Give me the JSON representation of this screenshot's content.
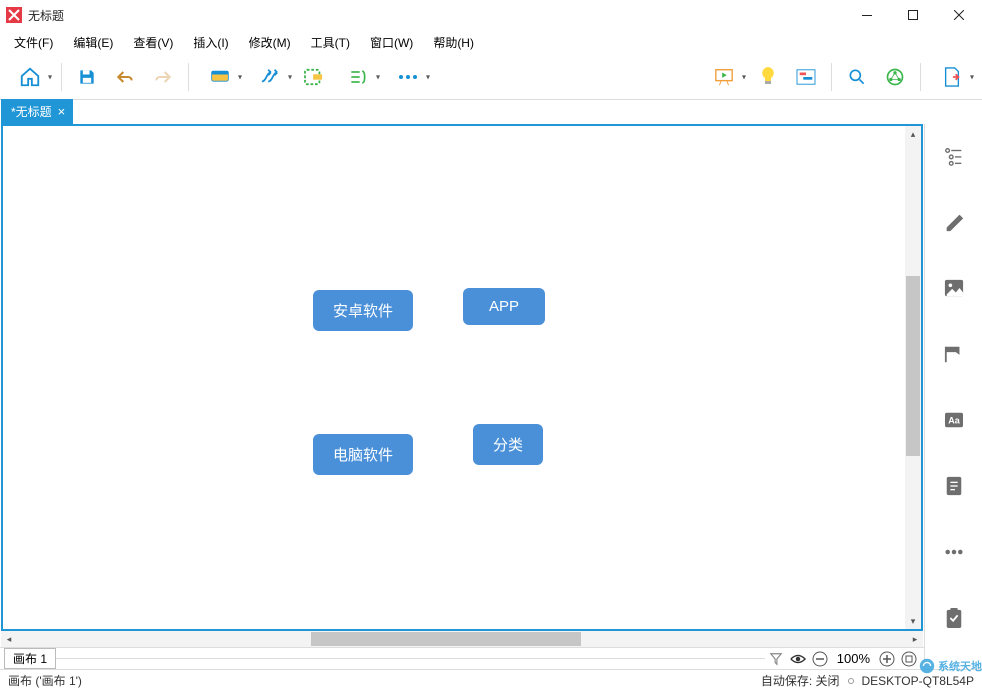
{
  "window": {
    "title": "无标题"
  },
  "menubar": {
    "items": [
      "文件(F)",
      "编辑(E)",
      "查看(V)",
      "插入(I)",
      "修改(M)",
      "工具(T)",
      "窗口(W)",
      "帮助(H)"
    ]
  },
  "tabs": [
    {
      "label": "*无标题"
    }
  ],
  "canvas": {
    "nodes": [
      {
        "label": "安卓软件"
      },
      {
        "label": "APP"
      },
      {
        "label": "电脑软件"
      },
      {
        "label": "分类"
      }
    ]
  },
  "sheetbar": {
    "sheet_label": "画布 1",
    "zoom_label": "100%"
  },
  "statusbar": {
    "left": "画布 ('画布 1')",
    "autosave": "自动保存: 关闭",
    "host": "DESKTOP-QT8L54P"
  },
  "watermark": {
    "text": "系统天地"
  },
  "colors": {
    "accent": "#2196d6",
    "node": "#4a90d9"
  }
}
